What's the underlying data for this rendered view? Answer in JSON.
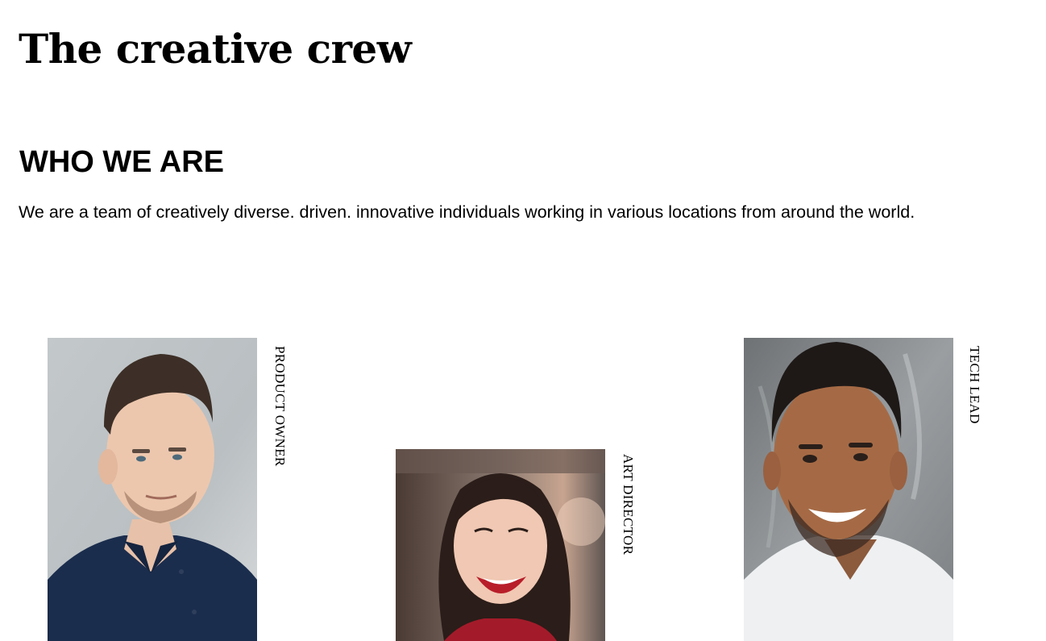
{
  "header": {
    "title": "The creative crew"
  },
  "about": {
    "heading": "WHO WE ARE",
    "text": "We are a team of creatively diverse. driven. innovative individuals working in various locations from around the world."
  },
  "team": [
    {
      "role": "PRODUCT OWNER"
    },
    {
      "role": "ART DIRECTOR"
    },
    {
      "role": "TECH LEAD"
    }
  ]
}
